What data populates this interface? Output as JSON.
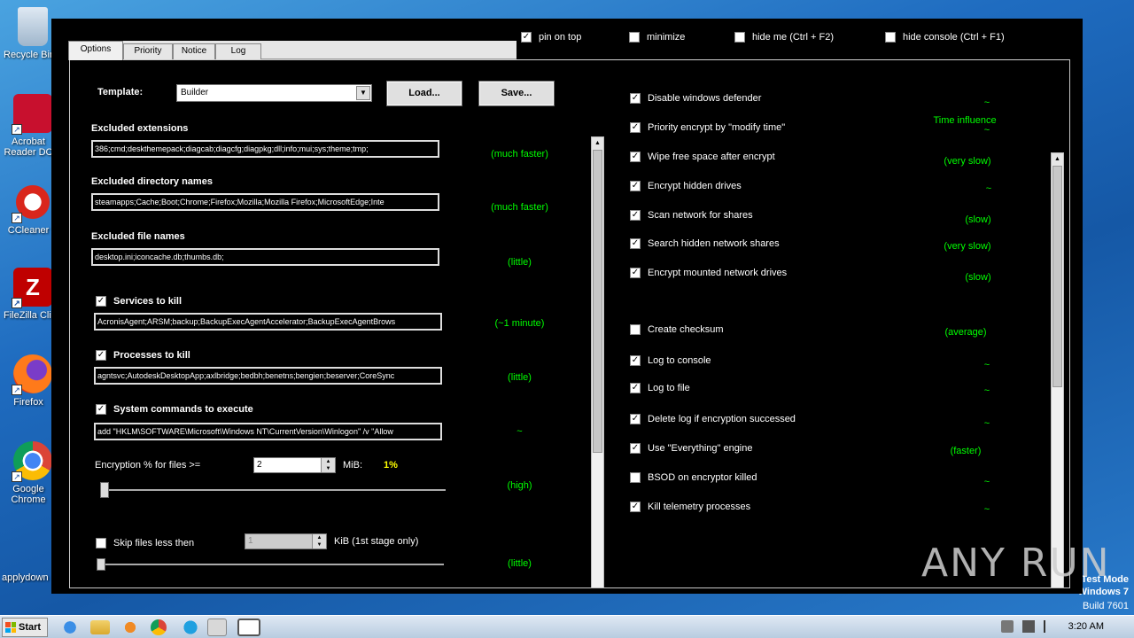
{
  "desktop": {
    "icons": [
      {
        "label": "Recycle Bin",
        "icon": "recycle-bin-icon"
      },
      {
        "label": "Acrobat Reader DC",
        "icon": "acrobat-icon"
      },
      {
        "label": "CCleaner",
        "icon": "ccleaner-icon"
      },
      {
        "label": "FileZilla Client",
        "icon": "filezilla-icon"
      },
      {
        "label": "Firefox",
        "icon": "firefox-icon"
      },
      {
        "label": "Google Chrome",
        "icon": "chrome-icon"
      },
      {
        "label": "applydown",
        "icon": "file-icon"
      }
    ],
    "watermark": {
      "line1": "Test Mode",
      "line2": "Windows 7",
      "line3": "Build 7601"
    }
  },
  "window": {
    "top_checks": [
      {
        "label": "pin on top",
        "checked": true
      },
      {
        "label": "minimize",
        "checked": false
      },
      {
        "label": "hide me (Ctrl + F2)",
        "checked": false
      },
      {
        "label": "hide console (Ctrl + F1)",
        "checked": false
      }
    ],
    "tabs": [
      "Options",
      "Priority",
      "Notice",
      "Log"
    ],
    "active_tab": "Options",
    "template": {
      "label": "Template:",
      "value": "Builder",
      "load": "Load...",
      "save": "Save..."
    },
    "left": {
      "excluded_extensions": {
        "label": "Excluded extensions",
        "value": "386;cmd;deskthemepack;diagcab;diagcfg;diagpkg;dll;info;mui;sys;theme;tmp;",
        "note": "(much faster)"
      },
      "excluded_dirs": {
        "label": "Excluded directory names",
        "value": "steamapps;Cache;Boot;Chrome;Firefox;Mozilla;Mozilla Firefox;MicrosoftEdge;Inte",
        "note": "(much faster)"
      },
      "excluded_files": {
        "label": "Excluded file names",
        "value": "desktop.ini;iconcache.db;thumbs.db;",
        "note": "(little)"
      },
      "services": {
        "label": "Services to kill",
        "checked": true,
        "value": "AcronisAgent;ARSM;backup;BackupExecAgentAccelerator;BackupExecAgentBrows",
        "note": "(~1 minute)"
      },
      "processes": {
        "label": "Processes to kill",
        "checked": true,
        "value": "agntsvc;AutodeskDesktopApp;axlbridge;bedbh;benetns;bengien;beserver;CoreSync",
        "note": "(little)"
      },
      "commands": {
        "label": "System commands to execute",
        "checked": true,
        "value": "add \"HKLM\\SOFTWARE\\Microsoft\\Windows NT\\CurrentVersion\\Winlogon\" /v \"Allow",
        "note": "~"
      },
      "encryption": {
        "label": "Encryption % for files >=",
        "value": "2",
        "unit": "MiB:",
        "percent": "1%",
        "note": "(high)"
      },
      "skip": {
        "label": "Skip files less then",
        "checked": false,
        "value": "1",
        "unit": "KiB (1st stage only)",
        "note": "(little)"
      }
    },
    "right": {
      "header": "Time influence",
      "options": [
        {
          "label": "Disable windows defender",
          "checked": true,
          "note": "~"
        },
        {
          "label": "Priority encrypt by \"modify time\"",
          "checked": true,
          "note": "~"
        },
        {
          "label": "Wipe free space after encrypt",
          "checked": true,
          "note": "(very slow)"
        },
        {
          "label": "Encrypt hidden drives",
          "checked": true,
          "note": "~"
        },
        {
          "label": "Scan network for shares",
          "checked": true,
          "note": "(slow)"
        },
        {
          "label": "Search hidden network shares",
          "checked": true,
          "note": "(very slow)"
        },
        {
          "label": "Encrypt mounted network drives",
          "checked": true,
          "note": "(slow)"
        },
        {
          "label": "Create checksum",
          "checked": false,
          "note": "(average)"
        },
        {
          "label": "Log to console",
          "checked": true,
          "note": "~"
        },
        {
          "label": "Log to file",
          "checked": true,
          "note": "~"
        },
        {
          "label": "Delete log if encryption successed",
          "checked": true,
          "note": "~"
        },
        {
          "label": "Use \"Everything\" engine",
          "checked": true,
          "note": "(faster)"
        },
        {
          "label": "BSOD on encryptor killed",
          "checked": false,
          "note": "~"
        },
        {
          "label": "Kill telemetry processes",
          "checked": true,
          "note": "~"
        }
      ]
    }
  },
  "taskbar": {
    "start": "Start",
    "clock": "3:20 AM"
  },
  "overlay": {
    "brand": "ANY RUN"
  }
}
